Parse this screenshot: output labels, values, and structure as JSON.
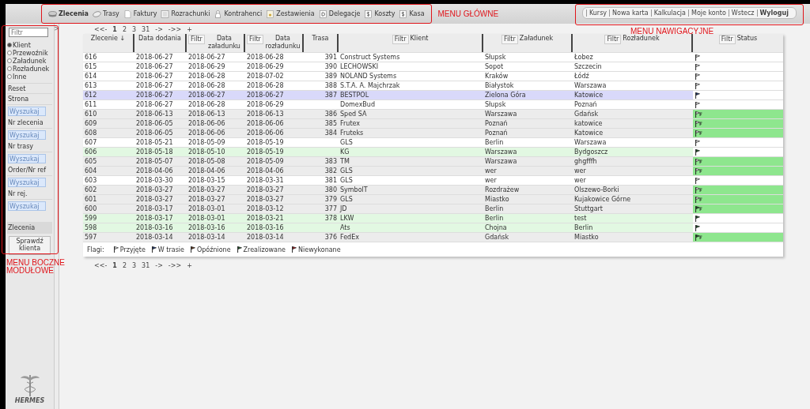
{
  "main_menu": [
    {
      "label": "Zlecenia",
      "selected": true
    },
    {
      "label": "Trasy",
      "selected": false
    },
    {
      "label": "Faktury",
      "selected": false
    },
    {
      "label": "Rozrachunki",
      "selected": false
    },
    {
      "label": "Kontrahenci",
      "selected": false
    },
    {
      "label": "Zestawienia",
      "selected": false
    },
    {
      "label": "Delegacje",
      "selected": false
    },
    {
      "label": "Koszty",
      "selected": false
    },
    {
      "label": "Kasa",
      "selected": false
    }
  ],
  "nav_menu": [
    {
      "label": "Kursy",
      "bold": false
    },
    {
      "label": "Nowa karta",
      "bold": false
    },
    {
      "label": "Kalkulacja",
      "bold": false
    },
    {
      "label": "Moje konto",
      "bold": false
    },
    {
      "label": "Wstecz",
      "bold": false
    },
    {
      "label": "Wyloguj",
      "bold": true
    }
  ],
  "annotations": [
    {
      "text": "MENU GŁÓWNE"
    },
    {
      "text": "MENU NAWIGACYJNE"
    },
    {
      "text": "MENU BOCZNE MODUŁOWE"
    }
  ],
  "sidebar": {
    "filter_placeholder": "Filtr",
    "toggle": ">",
    "radios": [
      {
        "label": "Klient",
        "selected": true
      },
      {
        "label": "Przewoźnik",
        "selected": false
      },
      {
        "label": "Załadunek",
        "selected": false
      },
      {
        "label": "Rozładunek",
        "selected": false
      },
      {
        "label": "Inne",
        "selected": false
      }
    ],
    "reset": "Reset",
    "searches": [
      {
        "label": "Strona",
        "placeholder": "Wyszukaj"
      },
      {
        "label": "Nr zlecenia",
        "placeholder": "Wyszukaj"
      },
      {
        "label": "Nr trasy",
        "placeholder": "Wyszukaj"
      },
      {
        "label": "Order/Nr ref",
        "placeholder": "Wyszukaj"
      },
      {
        "label": "Nr rej.",
        "placeholder": "Wyszukaj"
      }
    ],
    "section": "Zlecenia",
    "check_button": "Sprawdź klienta",
    "logo": "HERMES"
  },
  "pagination_top": [
    {
      "label": "<<-",
      "selected": false
    },
    {
      "label": "1",
      "selected": true
    },
    {
      "label": "2",
      "selected": false
    },
    {
      "label": "3",
      "selected": false
    },
    {
      "label": "31",
      "selected": false
    },
    {
      "label": "->",
      "selected": false
    },
    {
      "label": "->>",
      "selected": false
    },
    {
      "label": "+",
      "selected": false
    }
  ],
  "pagination_bottom": [
    {
      "label": "<<-",
      "selected": false
    },
    {
      "label": "1",
      "selected": true
    },
    {
      "label": "2",
      "selected": false
    },
    {
      "label": "3",
      "selected": false
    },
    {
      "label": "31",
      "selected": false
    },
    {
      "label": "->",
      "selected": false
    },
    {
      "label": "->>",
      "selected": false
    },
    {
      "label": "+",
      "selected": false
    }
  ],
  "table": {
    "columns": [
      {
        "label": "Zlecenie ↓"
      },
      {
        "label": "Data dodania"
      },
      {
        "label": "Data załadunku",
        "filter": "Filtr"
      },
      {
        "label": "Data rozładunku",
        "filter": "Filtr"
      },
      {
        "label": "Trasa"
      },
      {
        "label": "Klient",
        "filter": "Filtr"
      },
      {
        "label": "Załadunek",
        "filter": "Filtr"
      },
      {
        "label": "Rozładunek",
        "filter": "Filtr"
      },
      {
        "label": "Status",
        "filter": "Filtr"
      }
    ],
    "rows": [
      {
        "order": "616",
        "added": "2018-06-27",
        "loading_date": "2018-06-27",
        "unloading_date": "2018-06-28",
        "route": "391",
        "client": "Construct Systems",
        "loading": "Słupsk",
        "unloading": "Łobez",
        "kind": "accepted",
        "invoiced": false,
        "selected": false
      },
      {
        "order": "615",
        "added": "2018-06-27",
        "loading_date": "2018-06-29",
        "unloading_date": "2018-06-29",
        "route": "390",
        "client": "LECHOWSKI",
        "loading": "Sopot",
        "unloading": "Szczecin",
        "kind": "accepted",
        "invoiced": false,
        "selected": false
      },
      {
        "order": "614",
        "added": "2018-06-27",
        "loading_date": "2018-06-28",
        "unloading_date": "2018-07-02",
        "route": "389",
        "client": "NOLAND Systems",
        "loading": "Kraków",
        "unloading": "Łódź",
        "kind": "accepted",
        "invoiced": false,
        "selected": false
      },
      {
        "order": "613",
        "added": "2018-06-27",
        "loading_date": "2018-06-28",
        "unloading_date": "2018-06-28",
        "route": "388",
        "client": "S.T.A. A. Majchrzak",
        "loading": "Białystok",
        "unloading": "Warszawa",
        "kind": "accepted",
        "invoiced": false,
        "selected": false
      },
      {
        "order": "612",
        "added": "2018-06-27",
        "loading_date": "2018-06-27",
        "unloading_date": "2018-06-27",
        "route": "387",
        "client": "BESTPOL",
        "loading": "Zielona Góra",
        "unloading": "Katowice",
        "kind": "in_transit",
        "invoiced": false,
        "selected": true
      },
      {
        "order": "611",
        "added": "2018-06-27",
        "loading_date": "2018-06-28",
        "unloading_date": "2018-06-29",
        "client": "DomexBud",
        "loading": "Słupsk",
        "unloading": "Poznań",
        "kind": "accepted",
        "invoiced": false,
        "selected": false
      },
      {
        "order": "610",
        "added": "2018-06-13",
        "loading_date": "2018-06-13",
        "unloading_date": "2018-06-13",
        "route": "386",
        "client": "Sped SA",
        "loading": "Warszawa",
        "unloading": "Gdańsk",
        "kind": "accepted",
        "invoiced": true,
        "selected": false
      },
      {
        "order": "609",
        "added": "2018-06-05",
        "loading_date": "2018-06-06",
        "unloading_date": "2018-06-06",
        "route": "385",
        "client": "Frutex",
        "loading": "Poznań",
        "unloading": "katowice",
        "kind": "accepted",
        "invoiced": true,
        "selected": false
      },
      {
        "order": "608",
        "added": "2018-06-05",
        "loading_date": "2018-06-06",
        "unloading_date": "2018-06-06",
        "route": "384",
        "client": "Fruteks",
        "loading": "Poznań",
        "unloading": "Katowice",
        "kind": "accepted",
        "invoiced": true,
        "selected": false
      },
      {
        "order": "607",
        "added": "2018-05-21",
        "loading_date": "2018-05-09",
        "unloading_date": "2018-05-19",
        "client": "GLS",
        "loading": "Berlin",
        "unloading": "Warszawa",
        "kind": "accepted",
        "invoiced": false,
        "selected": false
      },
      {
        "order": "606",
        "added": "2018-05-18",
        "loading_date": "2018-05-10",
        "unloading_date": "2018-05-19",
        "client": "KG",
        "loading": "Warszawa",
        "unloading": "Bydgoszcz",
        "kind": "completed",
        "invoiced": false,
        "selected": false
      },
      {
        "order": "605",
        "added": "2018-05-07",
        "loading_date": "2018-05-08",
        "unloading_date": "2018-05-09",
        "route": "383",
        "client": "TM",
        "loading": "Warszawa",
        "unloading": "ghgfffh",
        "kind": "accepted",
        "invoiced": true,
        "selected": false
      },
      {
        "order": "604",
        "added": "2018-04-06",
        "loading_date": "2018-04-06",
        "unloading_date": "2018-04-06",
        "route": "382",
        "client": "GLS",
        "loading": "wer",
        "unloading": "wer",
        "kind": "accepted",
        "invoiced": true,
        "selected": false
      },
      {
        "order": "603",
        "added": "2018-03-30",
        "loading_date": "2018-03-15",
        "unloading_date": "2018-03-31",
        "route": "381",
        "client": "GLS",
        "loading": "wer",
        "unloading": "wer",
        "kind": "accepted",
        "invoiced": false,
        "selected": false
      },
      {
        "order": "602",
        "added": "2018-03-27",
        "loading_date": "2018-03-27",
        "unloading_date": "2018-03-27",
        "route": "380",
        "client": "SymbolT",
        "loading": "Rozdrażew",
        "unloading": "Olszewo-Borki",
        "kind": "accepted",
        "invoiced": true,
        "selected": false
      },
      {
        "order": "601",
        "added": "2018-03-27",
        "loading_date": "2018-03-27",
        "unloading_date": "2018-03-27",
        "route": "379",
        "client": "GLS",
        "loading": "Miastko",
        "unloading": "Kujakowice Górne",
        "kind": "accepted",
        "invoiced": true,
        "selected": false
      },
      {
        "order": "600",
        "added": "2018-03-17",
        "loading_date": "2018-03-01",
        "unloading_date": "2018-03-12",
        "route": "377",
        "client": "JD",
        "loading": "Berlin",
        "unloading": "Stuttgart",
        "kind": "completed",
        "invoiced": true,
        "selected": false
      },
      {
        "order": "599",
        "added": "2018-03-17",
        "loading_date": "2018-03-01",
        "unloading_date": "2018-03-21",
        "route": "378",
        "client": "LKW",
        "loading": "Berlin",
        "unloading": "test",
        "kind": "completed",
        "invoiced": false,
        "selected": false
      },
      {
        "order": "598",
        "added": "2018-03-16",
        "loading_date": "2018-03-16",
        "unloading_date": "2018-03-16",
        "client": "Ats",
        "loading": "Chojna",
        "unloading": "Berlin",
        "kind": "completed",
        "invoiced": false,
        "selected": false
      },
      {
        "order": "597",
        "added": "2018-03-14",
        "loading_date": "2018-03-14",
        "unloading_date": "2018-03-14",
        "route": "376",
        "client": "FedEx",
        "loading": "Gdańsk",
        "unloading": "Miastko",
        "kind": "completed",
        "invoiced": true,
        "selected": false
      }
    ],
    "legend": {
      "label": "Flagi:",
      "items": [
        {
          "label": "Przyjęte",
          "kind": "accepted"
        },
        {
          "label": "W trasie",
          "kind": "in_transit"
        },
        {
          "label": "Opóźnione",
          "kind": "delayed"
        },
        {
          "label": "Zrealizowane",
          "kind": "completed"
        },
        {
          "label": "Niewykonane",
          "kind": "failed"
        }
      ]
    }
  }
}
